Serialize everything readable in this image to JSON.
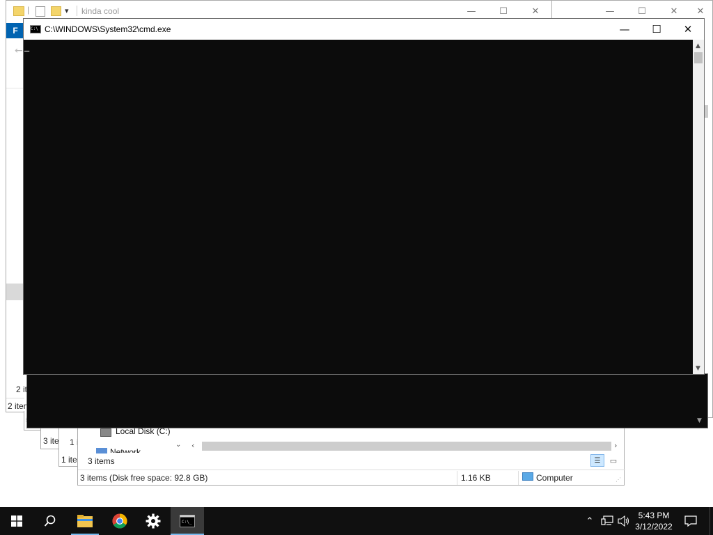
{
  "explorer_back": {
    "quick_access_separator": "|",
    "quick_access_dropdown": "▾",
    "title": "kinda cool",
    "ribbon_tab": "F",
    "status_top": "2 it",
    "status_bottom": "2 item"
  },
  "explorer_mid": {
    "status": "3 ite",
    "status2": "1 it"
  },
  "explorer_front": {
    "status_small": "1 ite",
    "nav_local_disk": "Local Disk (C:)",
    "nav_network": "Network",
    "items_count": "3 items",
    "status_disk": "3 items (Disk free space: 92.8 GB)",
    "status_size": "1.16 KB",
    "status_location": "Computer"
  },
  "cmd": {
    "title": "C:\\WINDOWS\\System32\\cmd.exe",
    "icon_text": "C:\\",
    "minimize": "—",
    "maximize": "☐",
    "close": "✕",
    "scroll_up": "▲",
    "scroll_down": "▼",
    "cursor": "_"
  },
  "taskbar": {
    "clock_time": "5:43 PM",
    "clock_date": "3/12/2022"
  },
  "colors": {
    "console_bg": "#0c0c0c",
    "taskbar_bg": "#101010",
    "accent": "#0063b1"
  }
}
